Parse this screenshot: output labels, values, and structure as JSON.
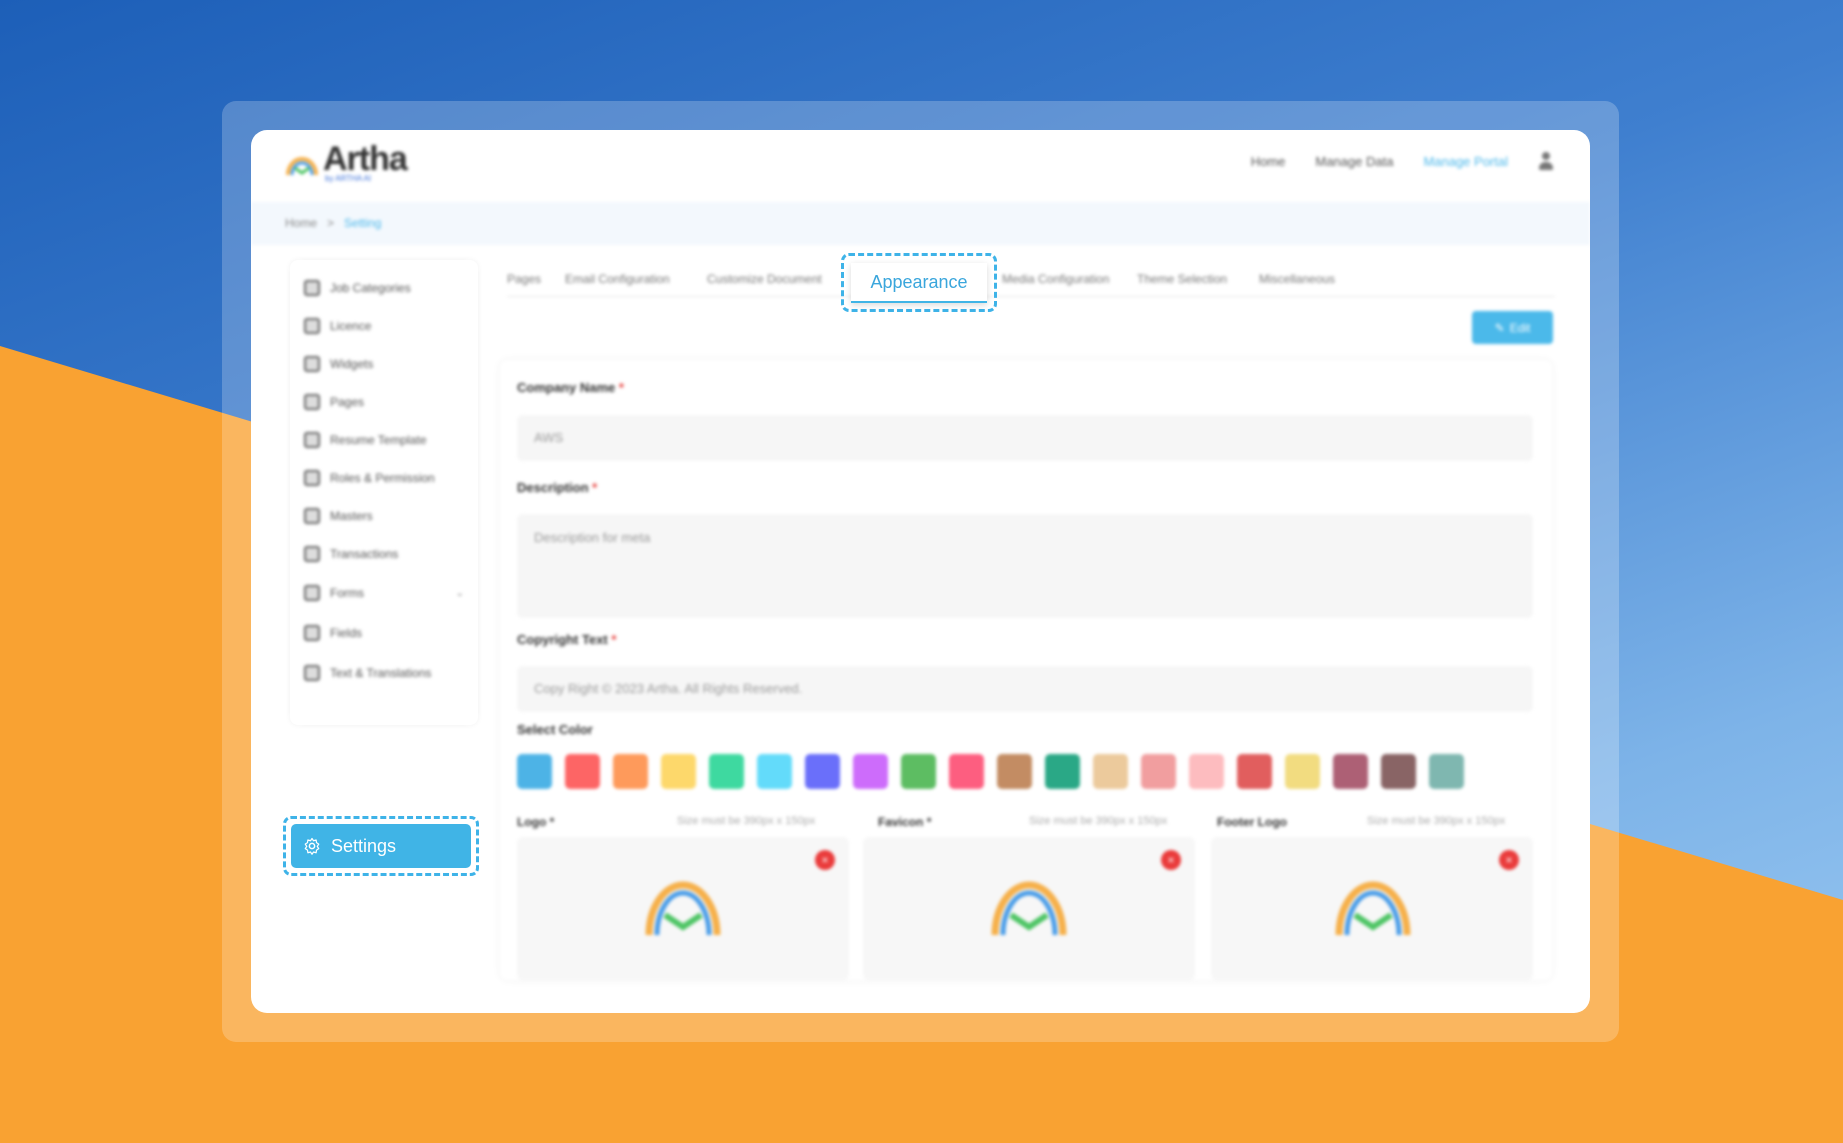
{
  "app": {
    "brand": "Artha",
    "brand_sub": "by ARTHA AI"
  },
  "header": {
    "nav": [
      {
        "label": "Home",
        "active": false
      },
      {
        "label": "Manage Data",
        "active": false
      },
      {
        "label": "Manage Portal",
        "active": true
      }
    ],
    "user_icon": "user-icon"
  },
  "breadcrumb": {
    "items": [
      "Home",
      "Setting"
    ],
    "separator": ">"
  },
  "sidebar": {
    "items": [
      {
        "label": "Job Categories",
        "icon": "briefcase-icon"
      },
      {
        "label": "Licence",
        "icon": "license-icon"
      },
      {
        "label": "Widgets",
        "icon": "widget-icon"
      },
      {
        "label": "Pages",
        "icon": "pages-icon"
      },
      {
        "label": "Resume Template",
        "icon": "document-icon"
      },
      {
        "label": "Roles & Permission",
        "icon": "roles-icon"
      },
      {
        "label": "Masters",
        "icon": "grid-icon"
      },
      {
        "label": "Transactions",
        "icon": "transactions-icon"
      },
      {
        "label": "Forms",
        "icon": "forms-icon",
        "has_children": true
      },
      {
        "label": "Fields",
        "icon": "fields-icon"
      },
      {
        "label": "Text & Translations",
        "icon": "translate-icon"
      }
    ],
    "active_item": {
      "label": "Settings",
      "icon": "gear-icon"
    }
  },
  "tabs": {
    "items": [
      "Pages",
      "Email Configuration",
      "Customize Document",
      "Appearance",
      "Media Configuration",
      "Theme Selection",
      "Miscellaneous"
    ],
    "active": "Appearance"
  },
  "toolbar": {
    "edit_label": "Edit"
  },
  "form": {
    "company_name": {
      "label": "Company Name",
      "required": "*",
      "value": "AWS"
    },
    "description": {
      "label": "Description",
      "required": "*",
      "value": "Description for meta"
    },
    "copyright": {
      "label": "Copyright Text",
      "required": "*",
      "value": "Copy Right © 2023 Artha. All Rights Reserved."
    },
    "color": {
      "label": "Select Color",
      "swatches": [
        "#4db3e6",
        "#fd6565",
        "#fe9a5b",
        "#fdd86b",
        "#3ed9a0",
        "#63dbfa",
        "#6a6ffa",
        "#cd6cfb",
        "#5dbd62",
        "#fd5e80",
        "#c38c63",
        "#2aa886",
        "#ecca9c",
        "#f19e9f",
        "#fdbcbf",
        "#e15e5e",
        "#f2dc80",
        "#ad6075",
        "#896465",
        "#7fb7b0"
      ]
    },
    "uploads": [
      {
        "label": "Logo",
        "required": "*",
        "hint": "Size must be 390px x 150px"
      },
      {
        "label": "Favicon",
        "required": "*",
        "hint": "Size must be 390px x 150px"
      },
      {
        "label": "Footer Logo",
        "required": "",
        "hint": "Size must be 390px x 150px"
      }
    ]
  }
}
